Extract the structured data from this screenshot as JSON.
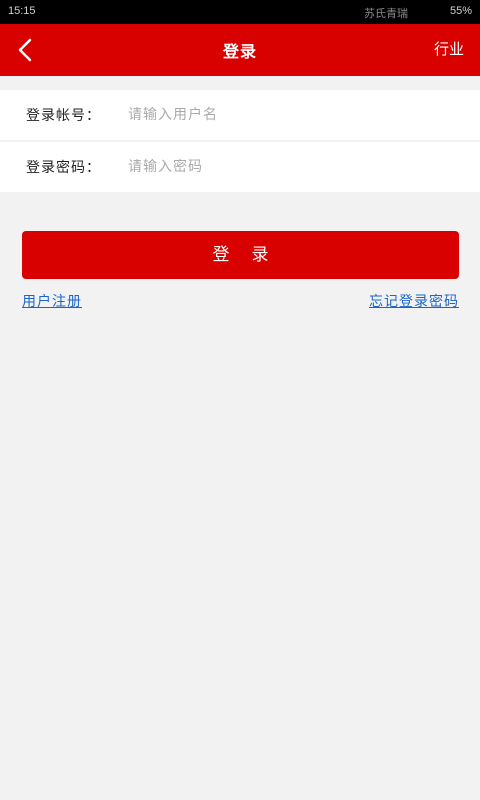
{
  "status_bar": {
    "time": "15:15",
    "carrier": "苏氏青瑞",
    "battery": "55%"
  },
  "nav": {
    "back_icon": "chevron-left-icon",
    "title": "登录",
    "right_label": "行业"
  },
  "form": {
    "account": {
      "label": "登录帐号：",
      "placeholder": "请输入用户名",
      "value": ""
    },
    "password": {
      "label": "登录密码：",
      "placeholder": "请输入密码",
      "value": ""
    }
  },
  "login_button": "登录",
  "links": {
    "register": "用户注册",
    "forgot_password": "忘记登录密码"
  },
  "colors": {
    "brand_red": "#d90000",
    "link_blue": "#1a66cc",
    "background": "#f2f2f2"
  }
}
